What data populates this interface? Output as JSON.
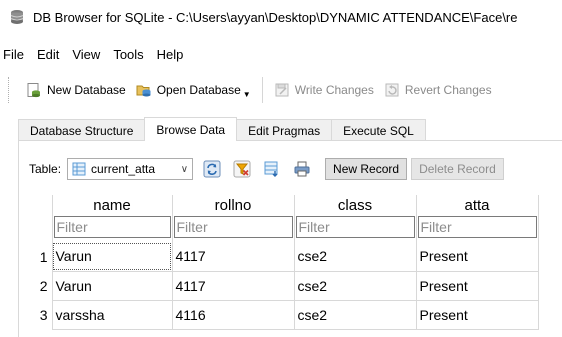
{
  "window": {
    "title": "DB Browser for SQLite - C:\\Users\\ayyan\\Desktop\\DYNAMIC ATTENDANCE\\Face\\re"
  },
  "menu": {
    "items": [
      "File",
      "Edit",
      "View",
      "Tools",
      "Help"
    ]
  },
  "toolbar": {
    "new_database": "New Database",
    "open_database": "Open Database",
    "write_changes": "Write Changes",
    "revert_changes": "Revert Changes"
  },
  "tabs": [
    {
      "label": "Database Structure",
      "active": false
    },
    {
      "label": "Browse Data",
      "active": true
    },
    {
      "label": "Edit Pragmas",
      "active": false
    },
    {
      "label": "Execute SQL",
      "active": false
    }
  ],
  "browse": {
    "table_label": "Table:",
    "selected_table": "current_atta",
    "new_record": "New Record",
    "delete_record": "Delete Record"
  },
  "grid": {
    "columns": [
      "name",
      "rollno",
      "class",
      "atta"
    ],
    "filter_placeholder": "Filter",
    "rows": [
      {
        "num": "1",
        "cells": [
          "Varun",
          "4117",
          "cse2",
          "Present"
        ]
      },
      {
        "num": "2",
        "cells": [
          "Varun",
          "4117",
          "cse2",
          "Present"
        ]
      },
      {
        "num": "3",
        "cells": [
          "varssha",
          "4116",
          "cse2",
          "Present"
        ]
      }
    ]
  },
  "colors": {
    "selected_tab_bg": "#ffffff",
    "tab_bg": "#f0f0f0",
    "disabled_text": "#8a8a8a"
  }
}
